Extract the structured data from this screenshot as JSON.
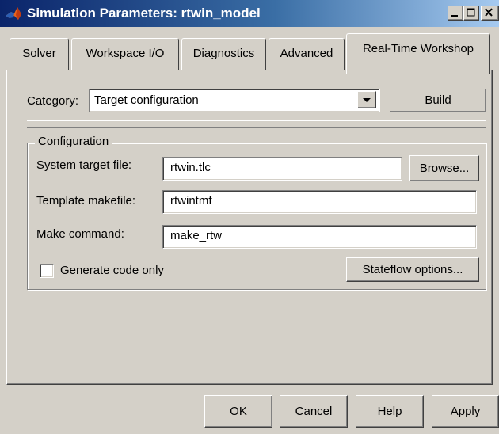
{
  "window": {
    "title": "Simulation Parameters: rtwin_model",
    "icon": "matlab-icon",
    "controls": [
      "minimize-icon",
      "maximize-icon",
      "close-icon"
    ]
  },
  "tabs": [
    {
      "label": "Solver",
      "active": false
    },
    {
      "label": "Workspace I/O",
      "active": false
    },
    {
      "label": "Diagnostics",
      "active": false
    },
    {
      "label": "Advanced",
      "active": false
    },
    {
      "label": "Real-Time Workshop",
      "active": true
    }
  ],
  "category": {
    "label": "Category:",
    "value": "Target configuration",
    "build_label": "Build"
  },
  "configuration": {
    "legend": "Configuration",
    "system_target_label": "System target file:",
    "system_target_value": "rtwin.tlc",
    "browse_label": "Browse...",
    "template_label": "Template makefile:",
    "template_value": "rtwintmf",
    "make_label": "Make command:",
    "make_value": "make_rtw",
    "generate_label": "Generate code only",
    "generate_checked": false,
    "stateflow_label": "Stateflow options..."
  },
  "footer": {
    "ok": "OK",
    "cancel": "Cancel",
    "help": "Help",
    "apply": "Apply"
  }
}
